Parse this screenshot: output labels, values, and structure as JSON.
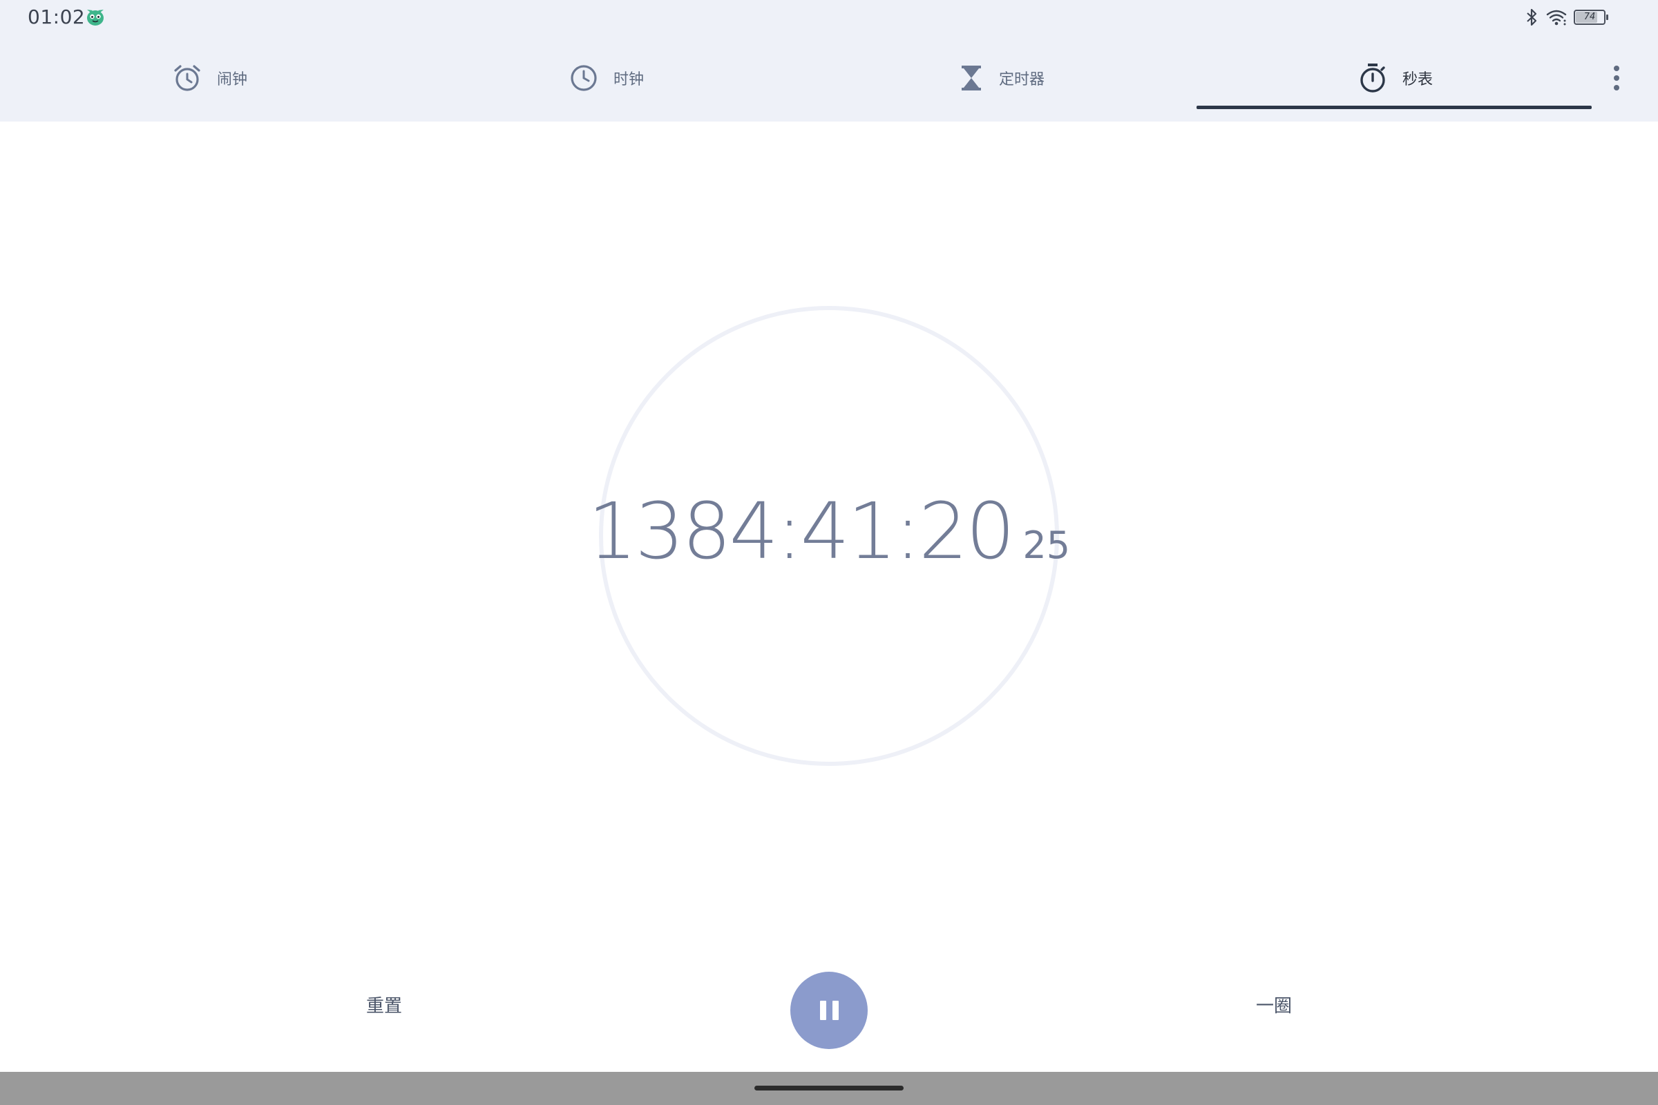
{
  "status_bar": {
    "time": "01:02",
    "battery_level": "74",
    "icons": [
      "android-mascot-icon",
      "bluetooth-icon",
      "wifi-icon",
      "battery-icon"
    ]
  },
  "tabs": [
    {
      "label": "闹钟",
      "icon": "alarm-clock-icon",
      "active": false
    },
    {
      "label": "时钟",
      "icon": "clock-icon",
      "active": false
    },
    {
      "label": "定时器",
      "icon": "hourglass-icon",
      "active": false
    },
    {
      "label": "秒表",
      "icon": "stopwatch-icon",
      "active": true
    }
  ],
  "menu": {
    "icon": "more-vert-icon"
  },
  "stopwatch": {
    "elapsed_main": "1384:41:20",
    "elapsed_hundredths": "25"
  },
  "controls": {
    "reset_label": "重置",
    "lap_label": "一圈",
    "pause_icon": "pause-icon"
  },
  "colors": {
    "header_bg": "#eef1f8",
    "accent": "#8b9bcc",
    "text": "#737d97",
    "indicator": "#2c3748"
  }
}
